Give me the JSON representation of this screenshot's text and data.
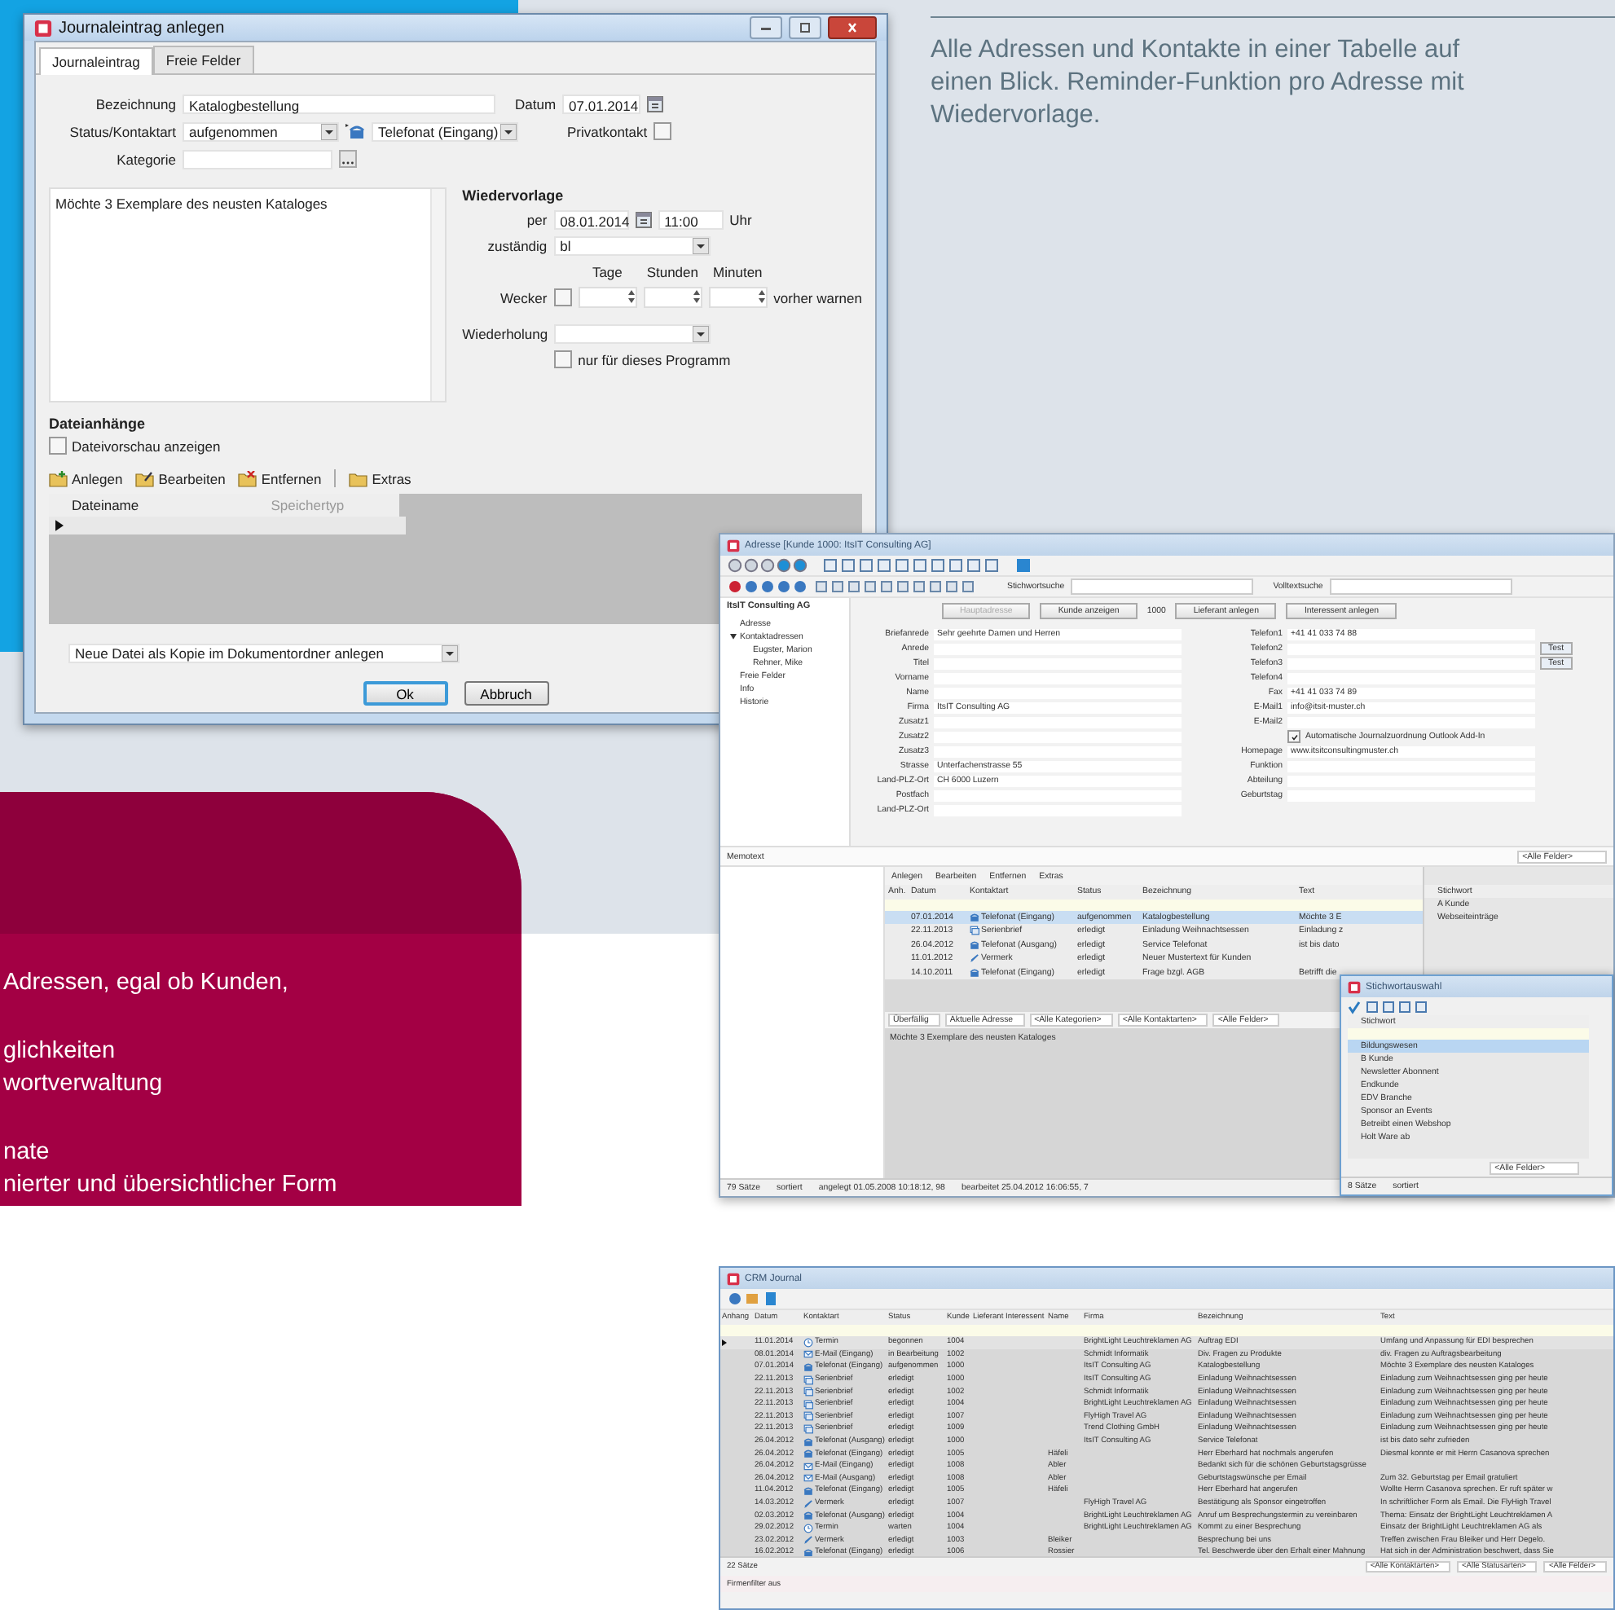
{
  "intro": {
    "lines": [
      "Alle Adressen und Kontakte in einer Tabelle auf",
      "einen Blick. Reminder-Funktion pro Adresse mit",
      "Wiedervorlage."
    ]
  },
  "feature_groups": [
    {
      "lines": [
        "Adressen, egal ob Kunden,"
      ]
    },
    {
      "lines": [
        "glichkeiten",
        "wortverwaltung"
      ]
    },
    {
      "lines": [
        "nate",
        "nierter und übersichtlicher Form"
      ]
    }
  ],
  "dialog": {
    "title": "Journaleintrag anlegen",
    "tabs": [
      {
        "label": "Journaleintrag",
        "selected": true
      },
      {
        "label": "Freie Felder",
        "selected": false
      }
    ],
    "bezeichnung": {
      "label": "Bezeichnung",
      "value": "Katalogbestellung"
    },
    "datum": {
      "label": "Datum",
      "value": "07.01.2014"
    },
    "status": {
      "label": "Status/Kontaktart",
      "value": "aufgenommen",
      "kontaktart": "Telefonat (Eingang)"
    },
    "privatkontakt": {
      "label": "Privatkontakt",
      "checked": false
    },
    "kategorie": {
      "label": "Kategorie"
    },
    "memo": "Möchte 3 Exemplare des neusten Kataloges",
    "wiedervorlage": {
      "heading": "Wiedervorlage",
      "per_label": "per",
      "date": "08.01.2014",
      "time": "11:00",
      "time_unit": "Uhr",
      "zustaendig_label": "zuständig",
      "zustaendig": "bl",
      "units": [
        "Tage",
        "Stunden",
        "Minuten"
      ],
      "wecker_label": "Wecker",
      "wecker_checked": false,
      "warn_label": "vorher warnen",
      "wiederholung_label": "Wiederholung",
      "only_program": {
        "label": "nur für dieses Programm",
        "checked": false
      }
    },
    "attachments": {
      "heading": "Dateianhänge",
      "preview": {
        "label": "Dateivorschau anzeigen",
        "checked": false
      },
      "toolbar": [
        {
          "kind": "add",
          "label": "Anlegen"
        },
        {
          "kind": "edit",
          "label": "Bearbeiten"
        },
        {
          "kind": "remove",
          "label": "Entfernen"
        },
        {
          "kind": "extras",
          "label": "Extras"
        }
      ],
      "columns": [
        "Dateiname",
        "Speichertyp"
      ]
    },
    "file_option": "Neue Datei als Kopie im Dokumentordner anlegen",
    "buttons": [
      {
        "label": "Ok",
        "default": true
      },
      {
        "label": "Abbruch",
        "default": false
      }
    ]
  },
  "address_window": {
    "title": "Adresse [Kunde 1000: ItsIT Consulting AG]",
    "keyword_search_label": "Stichwortsuche",
    "fulltext_search_label": "Volltextsuche",
    "company": "ItsIT Consulting AG",
    "tree": [
      {
        "label": "Adresse"
      },
      {
        "label": "Kontaktadressen",
        "children": [
          {
            "label": "Eugster, Marion"
          },
          {
            "label": "Rehner, Mike"
          }
        ]
      },
      {
        "label": "Freie Felder"
      },
      {
        "label": "Info"
      },
      {
        "label": "Historie"
      }
    ],
    "action_bar": [
      {
        "kind": "button",
        "label": "Hauptadresse",
        "disabled": true
      },
      {
        "kind": "button",
        "label": "Kunde anzeigen",
        "disabled": false
      },
      {
        "kind": "text",
        "label": "1000"
      },
      {
        "kind": "button",
        "label": "Lieferant anlegen",
        "disabled": false
      },
      {
        "kind": "button",
        "label": "Interessent anlegen",
        "disabled": false
      }
    ],
    "left_fields": [
      {
        "label": "Briefanrede",
        "value": "Sehr geehrte Damen und Herren"
      },
      {
        "label": "Anrede"
      },
      {
        "label": "Titel"
      },
      {
        "label": "Vorname"
      },
      {
        "label": "Name"
      },
      {
        "label": "Firma",
        "value": "ItsIT Consulting AG"
      },
      {
        "label": "Zusatz1"
      },
      {
        "label": "Zusatz2"
      },
      {
        "label": "Zusatz3"
      },
      {
        "label": "Strasse",
        "value": "Unterfachenstrasse 55"
      },
      {
        "label": "Land-PLZ-Ort",
        "value": "CH  6000  Luzern"
      },
      {
        "label": "Postfach"
      },
      {
        "label": "Land-PLZ-Ort"
      }
    ],
    "right_fields": [
      {
        "label": "Telefon1",
        "value": "+41 41 033 74 88"
      },
      {
        "label": "Telefon2"
      },
      {
        "label": "Telefon3"
      },
      {
        "label": "Telefon4"
      },
      {
        "label": "Fax",
        "value": "+41 41 033 74 89"
      },
      {
        "label": "E-Mail1",
        "value": "info@itsit-muster.ch"
      },
      {
        "label": "E-Mail2"
      },
      {
        "label": "Homepage",
        "value": "www.itsitconsultingmuster.ch"
      },
      {
        "label": "Funktion"
      },
      {
        "label": "Abteilung"
      },
      {
        "label": "Geburtstag"
      }
    ],
    "outlook_option": {
      "label": "Automatische Journalzuordnung Outlook Add-In",
      "checked": true
    },
    "test_buttons": [
      "Test",
      "Test"
    ],
    "memo_label": "Memotext",
    "all_fields": "<Alle Felder>",
    "journal_toolbar": [
      "Anlegen",
      "Bearbeiten",
      "Entfernen",
      "Extras"
    ],
    "journal_columns": [
      "Anh.",
      "Datum",
      "Kontaktart",
      "Status",
      "Bezeichnung",
      "Text"
    ],
    "journal_rows": [
      {
        "date": "07.01.2014",
        "kind": "phone",
        "type": "Telefonat (Eingang)",
        "status": "aufgenommen",
        "title": "Katalogbestellung",
        "text": "Möchte 3 E",
        "selected": true
      },
      {
        "date": "22.11.2013",
        "kind": "letter",
        "type": "Serienbrief",
        "status": "erledigt",
        "title": "Einladung Weihnachtsessen",
        "text": "Einladung z",
        "selected": false
      },
      {
        "date": "26.04.2012",
        "kind": "phone",
        "type": "Telefonat (Ausgang)",
        "status": "erledigt",
        "title": "Service Telefonat",
        "text": "ist bis dato",
        "selected": false
      },
      {
        "date": "11.01.2012",
        "kind": "note",
        "type": "Vermerk",
        "status": "erledigt",
        "title": "Neuer Mustertext für Kunden",
        "selected": false
      },
      {
        "date": "14.10.2011",
        "kind": "phone",
        "type": "Telefonat (Eingang)",
        "status": "erledigt",
        "title": "Frage bzgl. AGB",
        "text": "Betrifft die",
        "selected": false
      }
    ],
    "keyword_column": "Stichwort",
    "keywords": [
      "A Kunde",
      "Webseiteinträge"
    ],
    "filters": [
      "Überfällig",
      "Aktuelle Adresse",
      "<Alle Kategorien>",
      "<Alle Kontaktarten>",
      "<Alle Felder>"
    ],
    "journal_memo": "Möchte 3 Exemplare des neusten Kataloges",
    "status_bar": [
      "79 Sätze",
      "sortiert",
      "angelegt 01.05.2008 10:18:12, 98",
      "bearbeitet 25.04.2012 16:06:55, 7"
    ],
    "keyword_popup": {
      "title": "Stichwortauswahl",
      "column": "Stichwort",
      "items": [
        {
          "label": "Bildungswesen",
          "selected": true
        },
        {
          "label": "B Kunde",
          "selected": false
        },
        {
          "label": "Newsletter Abonnent",
          "selected": false
        },
        {
          "label": "Endkunde",
          "selected": false
        },
        {
          "label": "EDV Branche",
          "selected": false
        },
        {
          "label": "Sponsor an Events",
          "selected": false
        },
        {
          "label": "Betreibt einen Webshop",
          "selected": false
        },
        {
          "label": "Holt Ware ab",
          "selected": false
        }
      ],
      "filter": "<Alle Felder>",
      "status_bar": [
        "8 Sätze",
        "sortiert"
      ]
    }
  },
  "journal_window": {
    "title": "CRM Journal",
    "columns": [
      "Anhang",
      "Datum",
      "Kontaktart",
      "Status",
      "Kunde",
      "Lieferant",
      "Interessent",
      "Name",
      "Firma",
      "Bezeichnung",
      "Text"
    ],
    "rows": [
      {
        "date": "11.01.2014",
        "kind": "clock",
        "type": "Termin",
        "status": "begonnen",
        "kunde": "1004",
        "firma": "BrightLight Leuchtreklamen AG",
        "title": "Auftrag EDI",
        "text": "Umfang und Anpassung für EDI besprechen",
        "selected": true
      },
      {
        "date": "08.01.2014",
        "kind": "mail",
        "type": "E-Mail (Eingang)",
        "status": "in Bearbeitung",
        "kunde": "1002",
        "firma": "Schmidt Informatik",
        "title": "Div. Fragen zu Produkte",
        "text": "div. Fragen zu Auftragsbearbeitung",
        "selected": false
      },
      {
        "date": "07.01.2014",
        "kind": "phone",
        "type": "Telefonat (Eingang)",
        "status": "aufgenommen",
        "kunde": "1000",
        "firma": "ItsIT Consulting AG",
        "title": "Katalogbestellung",
        "text": "Möchte 3 Exemplare des neusten Kataloges",
        "selected": false
      },
      {
        "date": "22.11.2013",
        "kind": "letter",
        "type": "Serienbrief",
        "status": "erledigt",
        "kunde": "1000",
        "firma": "ItsIT Consulting AG",
        "title": "Einladung Weihnachtsessen",
        "text": "Einladung zum Weihnachtsessen ging per heute",
        "selected": false
      },
      {
        "date": "22.11.2013",
        "kind": "letter",
        "type": "Serienbrief",
        "status": "erledigt",
        "kunde": "1002",
        "firma": "Schmidt Informatik",
        "title": "Einladung Weihnachtsessen",
        "text": "Einladung zum Weihnachtsessen ging per heute",
        "selected": false
      },
      {
        "date": "22.11.2013",
        "kind": "letter",
        "type": "Serienbrief",
        "status": "erledigt",
        "kunde": "1004",
        "firma": "BrightLight Leuchtreklamen AG",
        "title": "Einladung Weihnachtsessen",
        "text": "Einladung zum Weihnachtsessen ging per heute",
        "selected": false
      },
      {
        "date": "22.11.2013",
        "kind": "letter",
        "type": "Serienbrief",
        "status": "erledigt",
        "kunde": "1007",
        "firma": "FlyHigh Travel AG",
        "title": "Einladung Weihnachtsessen",
        "text": "Einladung zum Weihnachtsessen ging per heute",
        "selected": false
      },
      {
        "date": "22.11.2013",
        "kind": "letter",
        "type": "Serienbrief",
        "status": "erledigt",
        "kunde": "1009",
        "firma": "Trend Clothing GmbH",
        "title": "Einladung Weihnachtsessen",
        "text": "Einladung zum Weihnachtsessen ging per heute",
        "selected": false
      },
      {
        "date": "26.04.2012",
        "kind": "phone",
        "type": "Telefonat (Ausgang)",
        "status": "erledigt",
        "kunde": "1000",
        "firma": "ItsIT Consulting AG",
        "title": "Service Telefonat",
        "text": "ist bis dato sehr zufrieden",
        "selected": false
      },
      {
        "date": "26.04.2012",
        "kind": "phone",
        "type": "Telefonat (Eingang)",
        "status": "erledigt",
        "kunde": "1005",
        "name": "Häfeli",
        "title": "Herr Eberhard hat nochmals angerufen",
        "text": "Diesmal konnte er mit Herrn Casanova sprechen",
        "selected": false
      },
      {
        "date": "26.04.2012",
        "kind": "mail",
        "type": "E-Mail (Eingang)",
        "status": "erledigt",
        "kunde": "1008",
        "name": "Abler",
        "title": "Bedankt sich für die schönen Geburtstagsgrüsse",
        "selected": false
      },
      {
        "date": "26.04.2012",
        "kind": "mail",
        "type": "E-Mail (Ausgang)",
        "status": "erledigt",
        "kunde": "1008",
        "name": "Abler",
        "title": "Geburtstagswünsche per Email",
        "text": "Zum 32. Geburtstag per Email gratuliert",
        "selected": false
      },
      {
        "date": "11.04.2012",
        "kind": "phone",
        "type": "Telefonat (Eingang)",
        "status": "erledigt",
        "kunde": "1005",
        "name": "Häfeli",
        "title": "Herr Eberhard hat angerufen",
        "text": "Wollte Herrn Casanova sprechen. Er ruft später w",
        "selected": false
      },
      {
        "date": "14.03.2012",
        "kind": "note",
        "type": "Vermerk",
        "status": "erledigt",
        "kunde": "1007",
        "firma": "FlyHigh Travel AG",
        "title": "Bestätigung als Sponsor eingetroffen",
        "text": "In schriftlicher Form als Email. Die FlyHigh Travel",
        "selected": false
      },
      {
        "date": "02.03.2012",
        "kind": "phone",
        "type": "Telefonat (Ausgang)",
        "status": "erledigt",
        "kunde": "1004",
        "firma": "BrightLight Leuchtreklamen AG",
        "title": "Anruf um Besprechungstermin zu vereinbaren",
        "text": "Thema: Einsatz der BrightLight Leuchtreklamen A",
        "selected": false
      },
      {
        "date": "29.02.2012",
        "kind": "clock",
        "type": "Termin",
        "status": "warten",
        "kunde": "1004",
        "firma": "BrightLight Leuchtreklamen AG",
        "title": "Kommt zu einer Besprechung",
        "text": "Einsatz der BrightLight Leuchtreklamen AG als",
        "selected": false
      },
      {
        "date": "23.02.2012",
        "kind": "note",
        "type": "Vermerk",
        "status": "erledigt",
        "kunde": "1003",
        "name": "Bleiker",
        "title": "Besprechung bei uns",
        "text": "Treffen zwischen Frau Bleiker und Herr Degelo.",
        "selected": false
      },
      {
        "date": "16.02.2012",
        "kind": "phone",
        "type": "Telefonat (Eingang)",
        "status": "erledigt",
        "kunde": "1006",
        "name": "Rossier",
        "title": "Tel. Beschwerde über den Erhalt einer Mahnung",
        "text": "Hat sich in der Administration beschwert, dass Sie",
        "selected": false
      }
    ],
    "count": "22 Sätze",
    "filters": [
      "<Alle Kontaktarten>",
      "<Alle Statusarten>",
      "<Alle Felder>"
    ],
    "company_filter": "Firmenfilter aus"
  }
}
